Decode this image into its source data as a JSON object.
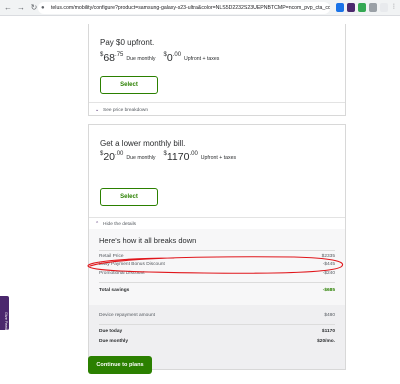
{
  "browser": {
    "url": "telus.com/mobility/configure?product=samsung-galaxy-s23-ultra&color=NLS5D2232S23UEPNBTCMP=ncom_pvp_cta_config&linktype=p..."
  },
  "plans": [
    {
      "title": "Pay $0 upfront.",
      "monthly": {
        "dollar": "$",
        "amount": "68",
        "cents": ".75",
        "label": "Due monthly"
      },
      "upfront": {
        "dollar": "$",
        "amount": "0",
        "cents": ".00",
        "label": "Upfront + taxes"
      },
      "select_label": "Select",
      "toggle_label": "See price breakdown"
    },
    {
      "title": "Get a lower monthly bill.",
      "monthly": {
        "dollar": "$",
        "amount": "20",
        "cents": ".00",
        "label": "Due monthly"
      },
      "upfront": {
        "dollar": "$",
        "amount": "1170",
        "cents": ".00",
        "label": "Upfront + taxes"
      },
      "select_label": "Select",
      "toggle_label": "Hide the details"
    }
  ],
  "breakdown": {
    "title": "Here's how it all breaks down",
    "rows": [
      {
        "label": "Retail Price",
        "value": "$2335"
      },
      {
        "label": "Easy Payment Bonus Discount",
        "value": "-$445"
      },
      {
        "label": "Promotional Discount",
        "value": "-$240"
      }
    ],
    "total_savings": {
      "label": "Total savings",
      "value": "-$685"
    },
    "repayment": {
      "label": "Device repayment amount",
      "value": "$480"
    },
    "due_today": {
      "label": "Due today",
      "value": "$1170"
    },
    "due_monthly": {
      "label": "Due monthly",
      "value": "$20/mo."
    }
  },
  "cta_label": "Continue to plans",
  "side_tab_label": "Give Feedback",
  "colors": {
    "brand_purple": "#4b286d",
    "brand_green": "#2b8000",
    "annotation_red": "#e0161b"
  }
}
